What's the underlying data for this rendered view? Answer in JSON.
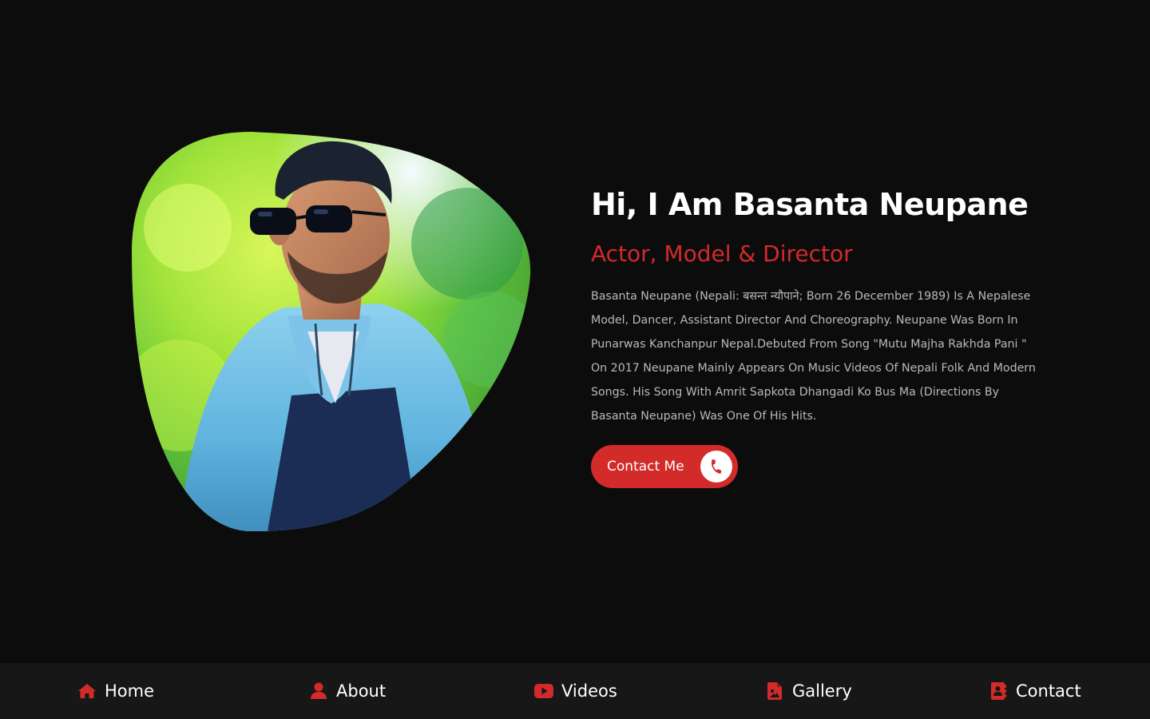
{
  "hero": {
    "portrait_alt": "Basanta Neupane portrait",
    "heading": "Hi, I Am Basanta Neupane",
    "subheading": "Actor, Model & Director",
    "bio": "Basanta Neupane (Nepali: बसन्त न्यौपाने; Born 26 December 1989) Is A Nepalese Model, Dancer, Assistant Director And Choreography. Neupane Was Born In Punarwas Kanchanpur Nepal.Debuted From Song \"Mutu Majha Rakhda Pani \" On 2017 Neupane Mainly Appears On Music Videos Of Nepali Folk And Modern Songs. His Song With Amrit Sapkota Dhangadi Ko Bus Ma (Directions By Basanta Neupane) Was One Of His Hits.",
    "contact_button": {
      "label": "Contact Me",
      "icon": "phone-icon"
    }
  },
  "nav": {
    "items": [
      {
        "label": "Home",
        "icon": "home-icon"
      },
      {
        "label": "About",
        "icon": "user-icon"
      },
      {
        "label": "Videos",
        "icon": "youtube-icon"
      },
      {
        "label": "Gallery",
        "icon": "image-file-icon"
      },
      {
        "label": "Contact",
        "icon": "address-book-icon"
      }
    ]
  },
  "colors": {
    "background": "#0c0c0d",
    "nav_background": "#171718",
    "accent": "#d32a2a",
    "heading": "#ffffff",
    "body_text": "#b9b9bb"
  }
}
